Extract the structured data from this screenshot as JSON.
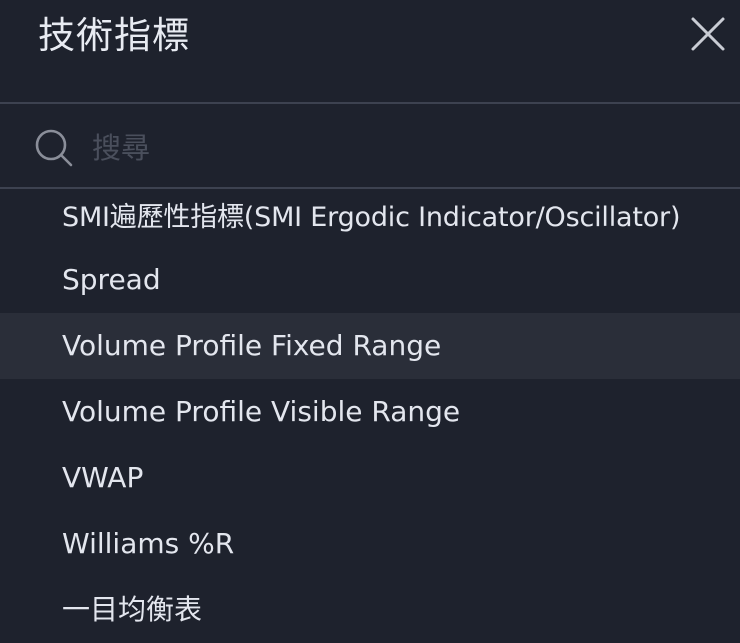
{
  "dialog": {
    "title": "技術指標",
    "close_icon": "close-icon"
  },
  "search": {
    "icon": "search-icon",
    "placeholder": "搜尋",
    "value": ""
  },
  "indicators": [
    {
      "label": "SMI遍歷性指標(SMI Ergodic Indicator/Oscillator)",
      "highlighted": false
    },
    {
      "label": "Spread",
      "highlighted": false
    },
    {
      "label": "Volume Profile Fixed Range",
      "highlighted": true
    },
    {
      "label": "Volume Profile Visible Range",
      "highlighted": false
    },
    {
      "label": "VWAP",
      "highlighted": false
    },
    {
      "label": "Williams %R",
      "highlighted": false
    },
    {
      "label": "一目均衡表",
      "highlighted": false
    }
  ],
  "colors": {
    "background": "#1e222d",
    "highlight": "#2a2e39",
    "divider": "#3d4250",
    "text": "#e3e6ee",
    "placeholder": "#4a4f5c"
  }
}
